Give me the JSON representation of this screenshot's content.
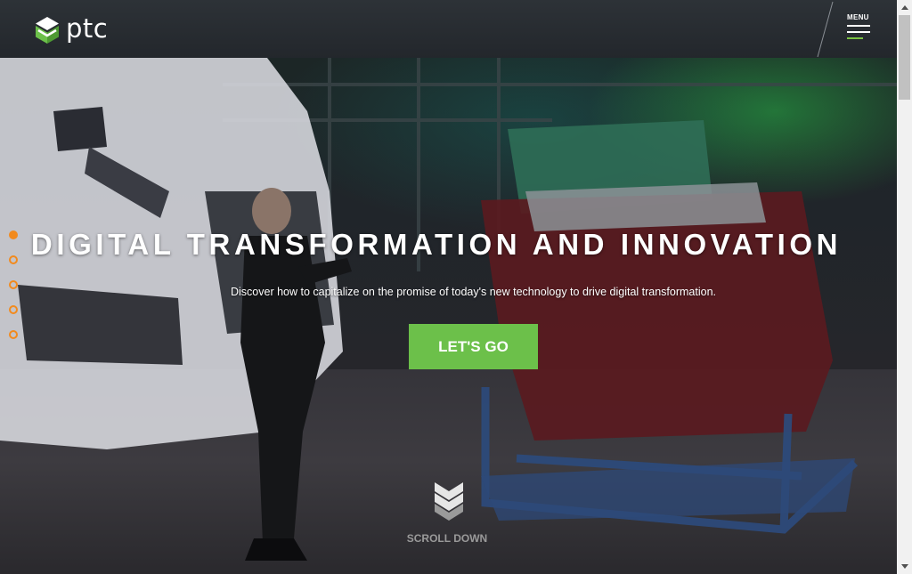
{
  "header": {
    "logo_text": "ptc",
    "menu_label": "MENU"
  },
  "hero": {
    "headline": "DIGITAL TRANSFORMATION AND INNOVATION",
    "subline": "Discover how to capitalize on the promise of today's new technology to drive digital transformation.",
    "cta_label": "LET'S GO",
    "scroll_label": "SCROLL DOWN",
    "slide_count": 5,
    "active_slide": 1
  },
  "colors": {
    "accent_green": "#6cc04a",
    "dot_orange": "#f28a1d",
    "header_bg": "#2d3237"
  },
  "icons": [
    "ptc-logo-icon",
    "menu-icon",
    "chevron-down-icon",
    "arrow-up-icon",
    "arrow-down-icon"
  ]
}
